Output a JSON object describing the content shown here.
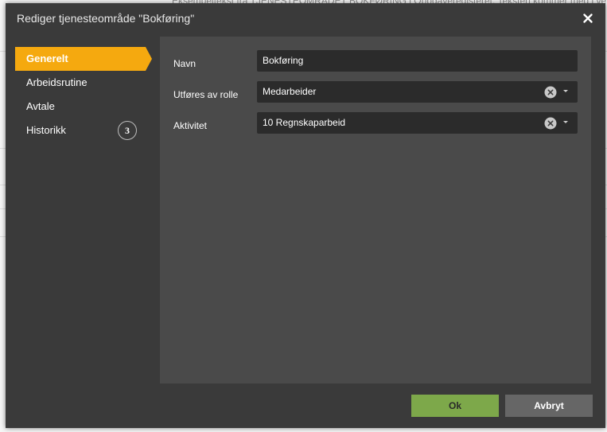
{
  "background": {
    "text": "Eksempeltekst fra TJENESTEOMRÅDET BOKFØRING i Oppgaveregisteret. Teksten kommer med i ve"
  },
  "dialog": {
    "title": "Rediger tjenesteområde \"Bokføring\"",
    "close_icon": "close-icon"
  },
  "sidebar": {
    "items": [
      {
        "label": "Generelt",
        "active": true
      },
      {
        "label": "Arbeidsrutine"
      },
      {
        "label": "Avtale"
      },
      {
        "label": "Historikk",
        "badge": "3"
      }
    ]
  },
  "form": {
    "fields": [
      {
        "label": "Navn",
        "value": "Bokføring"
      },
      {
        "label": "Utføres av rolle",
        "value": "Medarbeider"
      },
      {
        "label": "Aktivitet",
        "value": "10 Regnskaparbeid"
      }
    ]
  },
  "buttons": {
    "ok": "Ok",
    "cancel": "Avbryt"
  },
  "colors": {
    "accent": "#f5a90f",
    "ok_button": "#7da84a",
    "cancel_button": "#666666",
    "dialog_bg": "#3a3a3a",
    "panel_bg": "#4a4a4a",
    "field_bg": "#2b2b2b"
  }
}
